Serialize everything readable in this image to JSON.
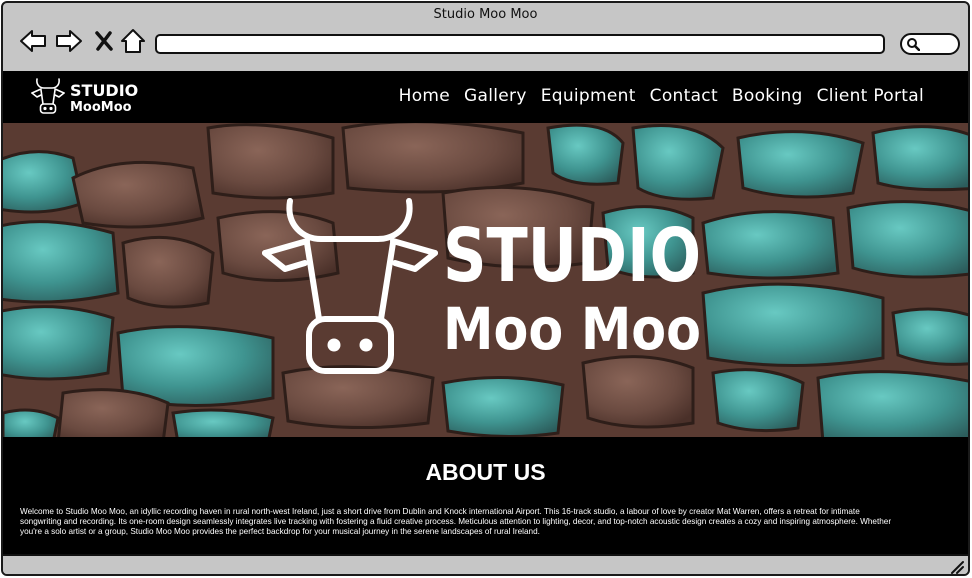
{
  "window": {
    "title": "Studio Moo Moo",
    "address": ""
  },
  "toolbar": {
    "icons": [
      "back-arrow-icon",
      "forward-arrow-icon",
      "close-x-icon",
      "home-icon",
      "search-icon"
    ]
  },
  "site": {
    "logo": {
      "line1": "STUDIO",
      "line2": "MooMoo"
    },
    "nav": [
      "Home",
      "Gallery",
      "Equipment",
      "Contact",
      "Booking",
      "Client Portal"
    ],
    "hero": {
      "line1": "STUDIO",
      "line2": "Moo Moo"
    },
    "about": {
      "heading": "ABOUT US",
      "body": "Welcome to Studio Moo Moo, an idyllic recording haven in rural north-west Ireland, just a short drive from Dublin and Knock international Airport. This 16-track studio, a labour of love by creator Mat Warren, offers a retreat for intimate songwriting and recording. Its one-room design seamlessly integrates live tracking with fostering a fluid creative process. Meticulous attention to lighting, decor, and top-notch acoustic design creates a cozy and inspiring atmosphere. Whether you're a solo artist or a group, Studio Moo Moo provides the perfect backdrop for your musical journey in the serene landscapes of rural Ireland."
    }
  },
  "colors": {
    "chrome": "#c6c6c6",
    "page_bg": "#000000",
    "text": "#ffffff",
    "stone_teal": "#4fb3ad",
    "stone_brown": "#6b4a3e"
  }
}
